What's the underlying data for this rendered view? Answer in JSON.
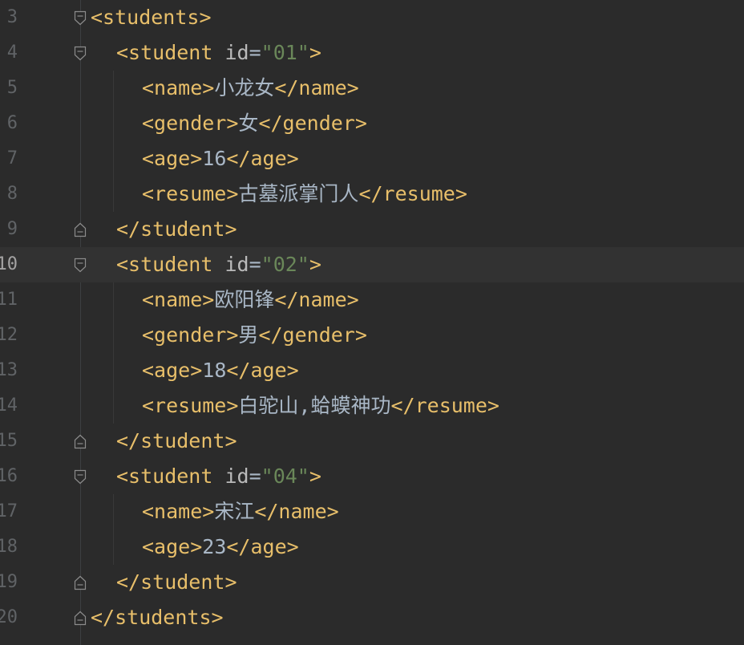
{
  "editor": {
    "lines": [
      {
        "num": "3",
        "indent": 0,
        "open": "<students>"
      },
      {
        "num": "4",
        "indent": 1,
        "open_start": "<student",
        "attr": "id",
        "eq": "=",
        "value": "\"01\"",
        "open_end": ">"
      },
      {
        "num": "5",
        "indent": 2,
        "open": "<name>",
        "text": "小龙女",
        "close": "</name>"
      },
      {
        "num": "6",
        "indent": 2,
        "open": "<gender>",
        "text": "女",
        "close": "</gender>"
      },
      {
        "num": "7",
        "indent": 2,
        "open": "<age>",
        "text": "16",
        "close": "</age>"
      },
      {
        "num": "8",
        "indent": 2,
        "open": "<resume>",
        "text": "古墓派掌门人",
        "close": "</resume>"
      },
      {
        "num": "9",
        "indent": 1,
        "close": "</student>"
      },
      {
        "num": "10",
        "indent": 1,
        "open_start": "<student",
        "attr": "id",
        "eq": "=",
        "value": "\"02\"",
        "open_end": ">",
        "current": true
      },
      {
        "num": "11",
        "indent": 2,
        "open": "<name>",
        "text": "欧阳锋",
        "close": "</name>"
      },
      {
        "num": "12",
        "indent": 2,
        "open": "<gender>",
        "text": "男",
        "close": "</gender>"
      },
      {
        "num": "13",
        "indent": 2,
        "open": "<age>",
        "text": "18",
        "close": "</age>"
      },
      {
        "num": "14",
        "indent": 2,
        "open": "<resume>",
        "text": "白驼山,蛤蟆神功",
        "close": "</resume>"
      },
      {
        "num": "15",
        "indent": 1,
        "close": "</student>"
      },
      {
        "num": "16",
        "indent": 1,
        "open_start": "<student",
        "attr": "id",
        "eq": "=",
        "value": "\"04\"",
        "open_end": ">"
      },
      {
        "num": "17",
        "indent": 2,
        "open": "<name>",
        "text": "宋江",
        "close": "</name>"
      },
      {
        "num": "18",
        "indent": 2,
        "open": "<age>",
        "text": "23",
        "close": "</age>"
      },
      {
        "num": "19",
        "indent": 1,
        "close": "</student>"
      },
      {
        "num": "20",
        "indent": 0,
        "close": "</students>"
      }
    ]
  },
  "colors": {
    "background": "#2b2b2b",
    "current_line": "#323232",
    "tag": "#e8bf6a",
    "attribute": "#bababa",
    "string": "#6a8759",
    "text": "#a9b7c6",
    "line_number": "#606366"
  },
  "icons": {
    "fold_open": "fold-expanded-icon",
    "fold_end": "fold-end-icon"
  }
}
